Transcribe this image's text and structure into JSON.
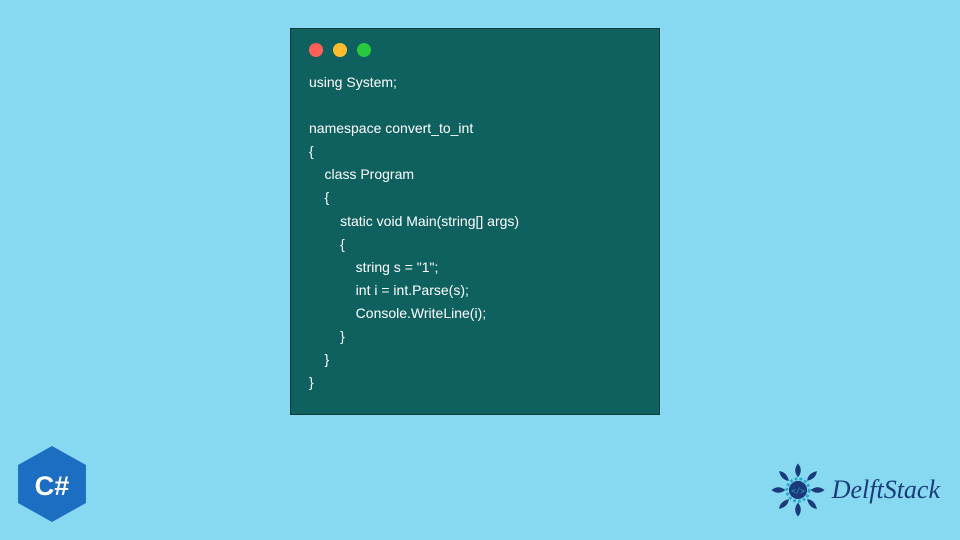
{
  "code_window": {
    "traffic_lights": [
      "red",
      "amber",
      "green"
    ],
    "lines": [
      "using System;",
      "",
      "namespace convert_to_int",
      "{",
      "    class Program",
      "    {",
      "        static void Main(string[] args)",
      "        {",
      "            string s = \"1\";",
      "            int i = int.Parse(s);",
      "            Console.WriteLine(i);",
      "        }",
      "    }",
      "}"
    ]
  },
  "badges": {
    "csharp_label": "C#",
    "delft_label": "DelftStack"
  }
}
